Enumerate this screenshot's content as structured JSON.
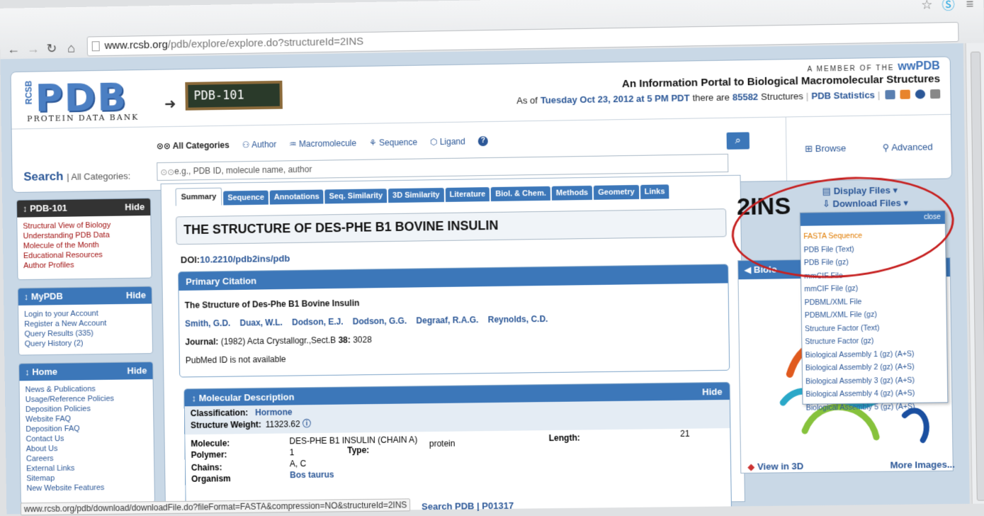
{
  "browser": {
    "url_domain": "www.rcsb.org",
    "url_path": "/pdb/explore/explore.do?structureId=2INS",
    "status_url": "www.rcsb.org/pdb/download/downloadFile.do?fileFormat=FASTA&compression=NO&structureId=2INS"
  },
  "header": {
    "logo_rcsb": "RCSB",
    "logo_pdb": "PDB",
    "logo_sub": "PROTEIN DATA BANK",
    "pdb101_badge": "PDB-101",
    "member_text": "A MEMBER OF THE",
    "member_logo": "wwPDB",
    "tagline": "An Information Portal to Biological Macromolecular Structures",
    "as_of_prefix": "As of",
    "as_of_date": "Tuesday Oct 23, 2012 at 5 PM PDT",
    "there_are": "there are",
    "structure_count": "85582",
    "structures_word": "Structures",
    "stats_link": "PDB Statistics"
  },
  "search": {
    "categories": [
      "All Categories",
      "Author",
      "Macromolecule",
      "Sequence",
      "Ligand"
    ],
    "label": "Search",
    "all_cat": "| All Categories:",
    "placeholder": "e.g., PDB ID, molecule name, author",
    "browse": "Browse",
    "advanced": "Advanced"
  },
  "sidebar": {
    "pdb101": {
      "title": "PDB-101",
      "hide": "Hide",
      "items": [
        "Structural View of Biology",
        "Understanding PDB Data",
        "Molecule of the Month",
        "Educational Resources",
        "Author Profiles"
      ]
    },
    "mypdb": {
      "title": "MyPDB",
      "hide": "Hide",
      "items": [
        "Login to your Account",
        "Register a New Account",
        "Query Results (335)",
        "Query History (2)"
      ]
    },
    "home": {
      "title": "Home",
      "hide": "Hide",
      "items": [
        "News & Publications",
        "Usage/Reference Policies",
        "Deposition Policies",
        "Website FAQ",
        "Deposition FAQ",
        "Contact Us",
        "About Us",
        "Careers",
        "External Links",
        "Sitemap",
        "New Website Features"
      ]
    }
  },
  "tabs": [
    "Summary",
    "Sequence",
    "Annotations",
    "Seq. Similarity",
    "3D Similarity",
    "Literature",
    "Biol. & Chem.",
    "Methods",
    "Geometry",
    "Links"
  ],
  "structure": {
    "title": "THE STRUCTURE OF DES-PHE B1 BOVINE INSULIN",
    "doi_label": "DOI:",
    "doi": "10.2210/pdb2ins/pdb",
    "pdb_id": "2INS"
  },
  "citation": {
    "header": "Primary Citation",
    "title": "The Structure of Des-Phe B1 Bovine Insulin",
    "authors": [
      "Smith, G.D.",
      "Duax, W.L.",
      "Dodson, E.J.",
      "Dodson, G.G.",
      "Degraaf, R.A.G.",
      "Reynolds, C.D."
    ],
    "journal_label": "Journal:",
    "journal": "(1982) Acta Crystallogr.,Sect.B",
    "volume": "38:",
    "page": "3028",
    "pubmed": "PubMed ID is not available"
  },
  "molecular": {
    "header": "Molecular Description",
    "hide": "Hide",
    "classification_label": "Classification:",
    "classification": "Hormone",
    "weight_label": "Structure Weight:",
    "weight": "11323.62",
    "molecule_label": "Molecule:",
    "molecule": "DES-PHE B1 INSULIN (CHAIN A)",
    "polymer_label": "Polymer:",
    "polymer": "1",
    "type_label": "Type:",
    "type": "protein",
    "length_label": "Length:",
    "length": "21",
    "chains_label": "Chains:",
    "chains": "A, C",
    "organism_label": "Organism",
    "organism": "Bos taurus",
    "search_pdb": "Search PDB",
    "uniprot": "P01317"
  },
  "files": {
    "display": "Display Files",
    "download": "Download Files",
    "close": "close",
    "menu": [
      "FASTA Sequence",
      "PDB File (Text)",
      "PDB File (gz)",
      "mmCIF File",
      "mmCIF File (gz)",
      "PDBML/XML File",
      "PDBML/XML File (gz)",
      "Structure Factor (Text)",
      "Structure Factor (gz)",
      "Biological Assembly 1 (gz) (A+S)",
      "Biological Assembly 2 (gz) (A+S)",
      "Biological Assembly 3 (gz) (A+S)",
      "Biological Assembly 4 (gz) (A+S)",
      "Biological Assembly 5 (gz) (A+S)"
    ]
  },
  "bio": {
    "header": "Biolo",
    "view3d": "View in 3D",
    "more_images": "More Images..."
  }
}
